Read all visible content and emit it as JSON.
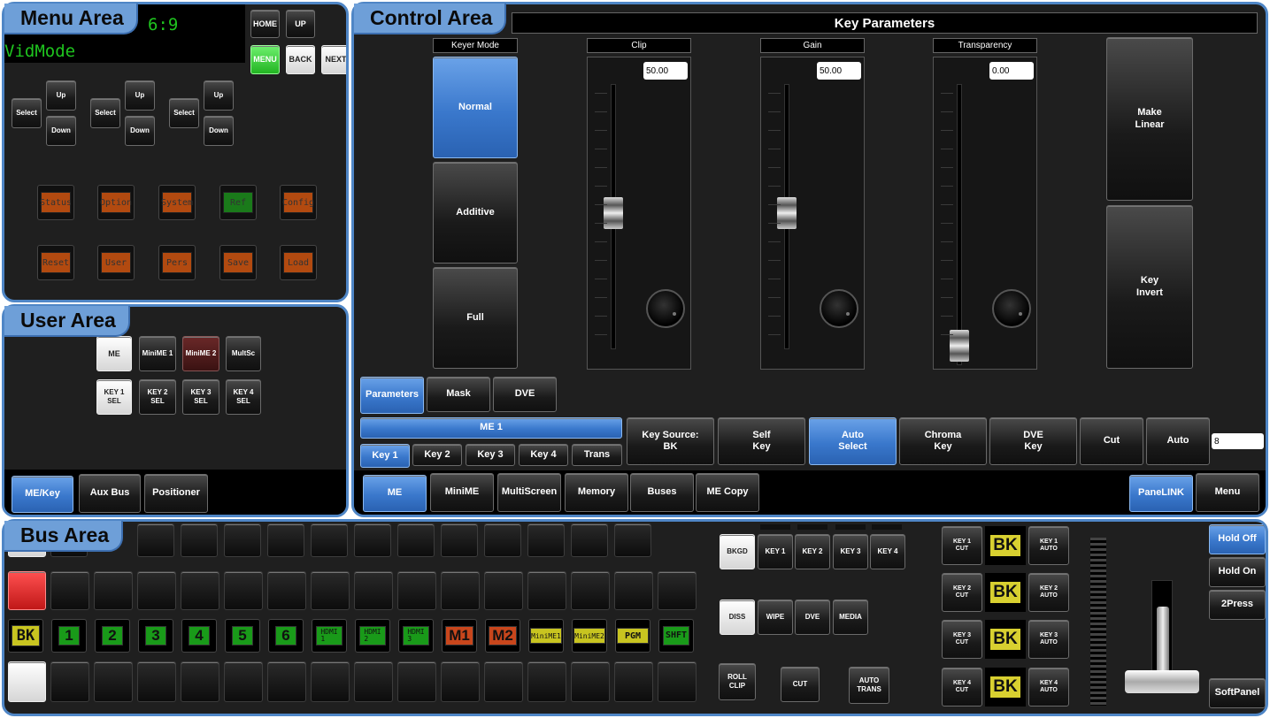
{
  "labels": {
    "menu": "Menu Area",
    "control": "Control Area",
    "user": "User Area",
    "bus": "Bus Area"
  },
  "menu": {
    "display": [
      "6:9",
      "VidMode"
    ],
    "nav": {
      "home": "HOME",
      "up": "UP",
      "menu": "MENU",
      "back": "BACK",
      "next": "NEXT"
    },
    "selectors": [
      {
        "select": "Select",
        "up": "Up",
        "down": "Down"
      },
      {
        "select": "Select",
        "up": "Up",
        "down": "Down"
      },
      {
        "select": "Select",
        "up": "Up",
        "down": "Down"
      }
    ],
    "row1": [
      "Status",
      "Option",
      "System",
      "Ref",
      "Config"
    ],
    "row2": [
      "Reset",
      "User",
      "Pers",
      "Save",
      "Load"
    ]
  },
  "user": {
    "row1": [
      "ME",
      "MiniME 1",
      "MiniME 2",
      "MultSc"
    ],
    "row2": [
      "KEY 1\nSEL",
      "KEY 2\nSEL",
      "KEY 3\nSEL",
      "KEY 4\nSEL"
    ],
    "tabs": [
      "ME/Key",
      "Aux Bus",
      "Positioner"
    ]
  },
  "control": {
    "title": "Key Parameters",
    "keyer_mode": {
      "header": "Keyer Mode",
      "options": [
        "Normal",
        "Additive",
        "Full"
      ],
      "selected": "Normal"
    },
    "sliders": [
      {
        "label": "Clip",
        "value": "50.00",
        "level": 0.5
      },
      {
        "label": "Gain",
        "value": "50.00",
        "level": 0.5
      },
      {
        "label": "Transparency",
        "value": "0.00",
        "level": 0
      }
    ],
    "right_buttons": [
      "Make\nLinear",
      "Key\nInvert"
    ],
    "param_tabs": [
      "Parameters",
      "Mask",
      "DVE"
    ],
    "me_label": "ME 1",
    "key_tabs": [
      "Key 1",
      "Key 2",
      "Key 3",
      "Key 4",
      "Trans"
    ],
    "key_buttons": [
      "Key Source:\nBK",
      "Self\nKey",
      "Auto\nSelect",
      "Chroma\nKey",
      "DVE\nKey",
      "Cut",
      "Auto"
    ],
    "auto_value": "8",
    "bottom_tabs": [
      "ME",
      "MiniME",
      "MultiScreen",
      "Memory",
      "Buses",
      "ME Copy"
    ],
    "panelink": "PaneLINK",
    "menu_btn": "Menu"
  },
  "bus": {
    "sources": [
      "BK",
      "1",
      "2",
      "3",
      "4",
      "5",
      "6",
      "HDMI\n1",
      "HDMI\n2",
      "HDMI\n3",
      "M1",
      "M2",
      "MiniME1",
      "MiniME2",
      "PGM",
      "SHFT"
    ],
    "next_trans": [
      "BKGD",
      "KEY 1",
      "KEY 2",
      "KEY 3",
      "KEY 4"
    ],
    "transition_type": [
      "DISS",
      "WIPE",
      "DVE",
      "MEDIA"
    ],
    "actions": [
      "ROLL\nCLIP",
      "CUT",
      "AUTO\nTRANS"
    ],
    "keys": [
      {
        "cut": "KEY 1\nCUT",
        "bk": "BK",
        "auto": "KEY 1\nAUTO"
      },
      {
        "cut": "KEY 2\nCUT",
        "bk": "BK",
        "auto": "KEY 2\nAUTO"
      },
      {
        "cut": "KEY 3\nCUT",
        "bk": "BK",
        "auto": "KEY 3\nAUTO"
      },
      {
        "cut": "KEY 4\nCUT",
        "bk": "BK",
        "auto": "KEY 4\nAUTO"
      }
    ],
    "hold": [
      "Hold Off",
      "Hold On",
      "2Press"
    ],
    "softpanel": "SoftPanel"
  }
}
